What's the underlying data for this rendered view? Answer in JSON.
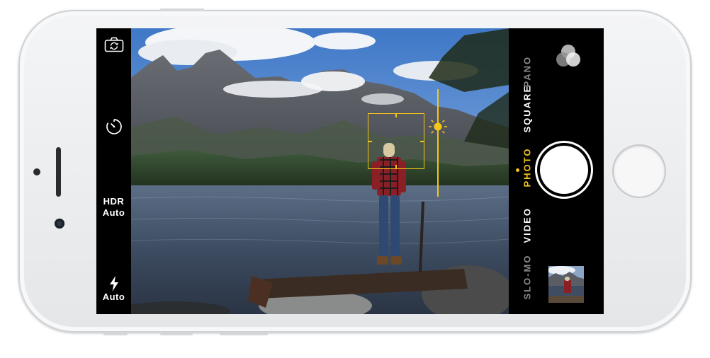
{
  "left_bar": {
    "hdr_label": "HDR",
    "hdr_value": "Auto",
    "flash_value": "Auto"
  },
  "modes": {
    "slomo": "SLO-MO",
    "video": "VIDEO",
    "photo": "PHOTO",
    "square": "SQUARE",
    "pano": "PANO"
  },
  "icons": {
    "flip": "camera-flip-icon",
    "timer": "timer-icon",
    "flash": "flash-icon",
    "filters": "filters-icon",
    "exposure": "sun-icon"
  },
  "colors": {
    "accent": "#f5c518",
    "bar": "#000000",
    "text": "#ffffff"
  }
}
